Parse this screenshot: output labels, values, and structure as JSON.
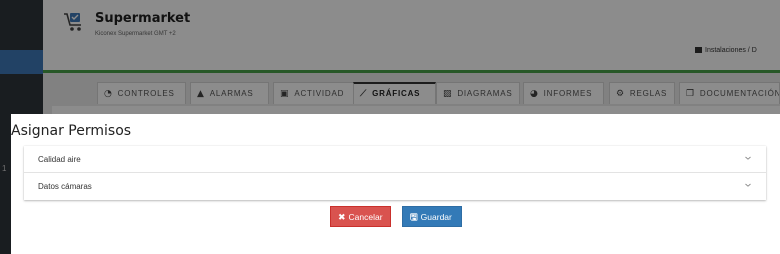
{
  "app": {
    "title": "Supermarket",
    "subtitle": "Kiconex Supermarket GMT +2",
    "breadcrumb": "Instalaciones  /  D",
    "colors": {
      "accent": "#49a049",
      "sidebar": "#2f353b",
      "sidebar_active": "#3f78b8"
    }
  },
  "sidebar": {
    "mark": "1"
  },
  "tabs": [
    {
      "label": "CONTROLES",
      "icon": "dashboard-icon",
      "glyph": "◔"
    },
    {
      "label": "ALARMAS",
      "icon": "bell-icon",
      "glyph": "▲"
    },
    {
      "label": "ACTIVIDAD",
      "icon": "calendar-icon",
      "glyph": "▣"
    },
    {
      "label": "GRÁFICAS",
      "icon": "line-chart-icon",
      "glyph": "⟋",
      "active": true
    },
    {
      "label": "DIAGRAMAS",
      "icon": "image-icon",
      "glyph": "▨"
    },
    {
      "label": "INFORMES",
      "icon": "pie-chart-icon",
      "glyph": "◕"
    },
    {
      "label": "REGLAS",
      "icon": "cogs-icon",
      "glyph": "⚙"
    },
    {
      "label": "DOCUMENTACIÓN",
      "icon": "documents-icon",
      "glyph": "❐"
    }
  ],
  "modal": {
    "title": "Asignar Permisos",
    "sections": [
      {
        "label": "Calidad aire"
      },
      {
        "label": "Datos cámaras"
      }
    ],
    "cancel_label": "Cancelar",
    "save_label": "Guardar",
    "cancel_glyph": "✖",
    "save_glyph": "🖫",
    "colors": {
      "cancel": "#d9534f",
      "save": "#337ab7"
    }
  }
}
